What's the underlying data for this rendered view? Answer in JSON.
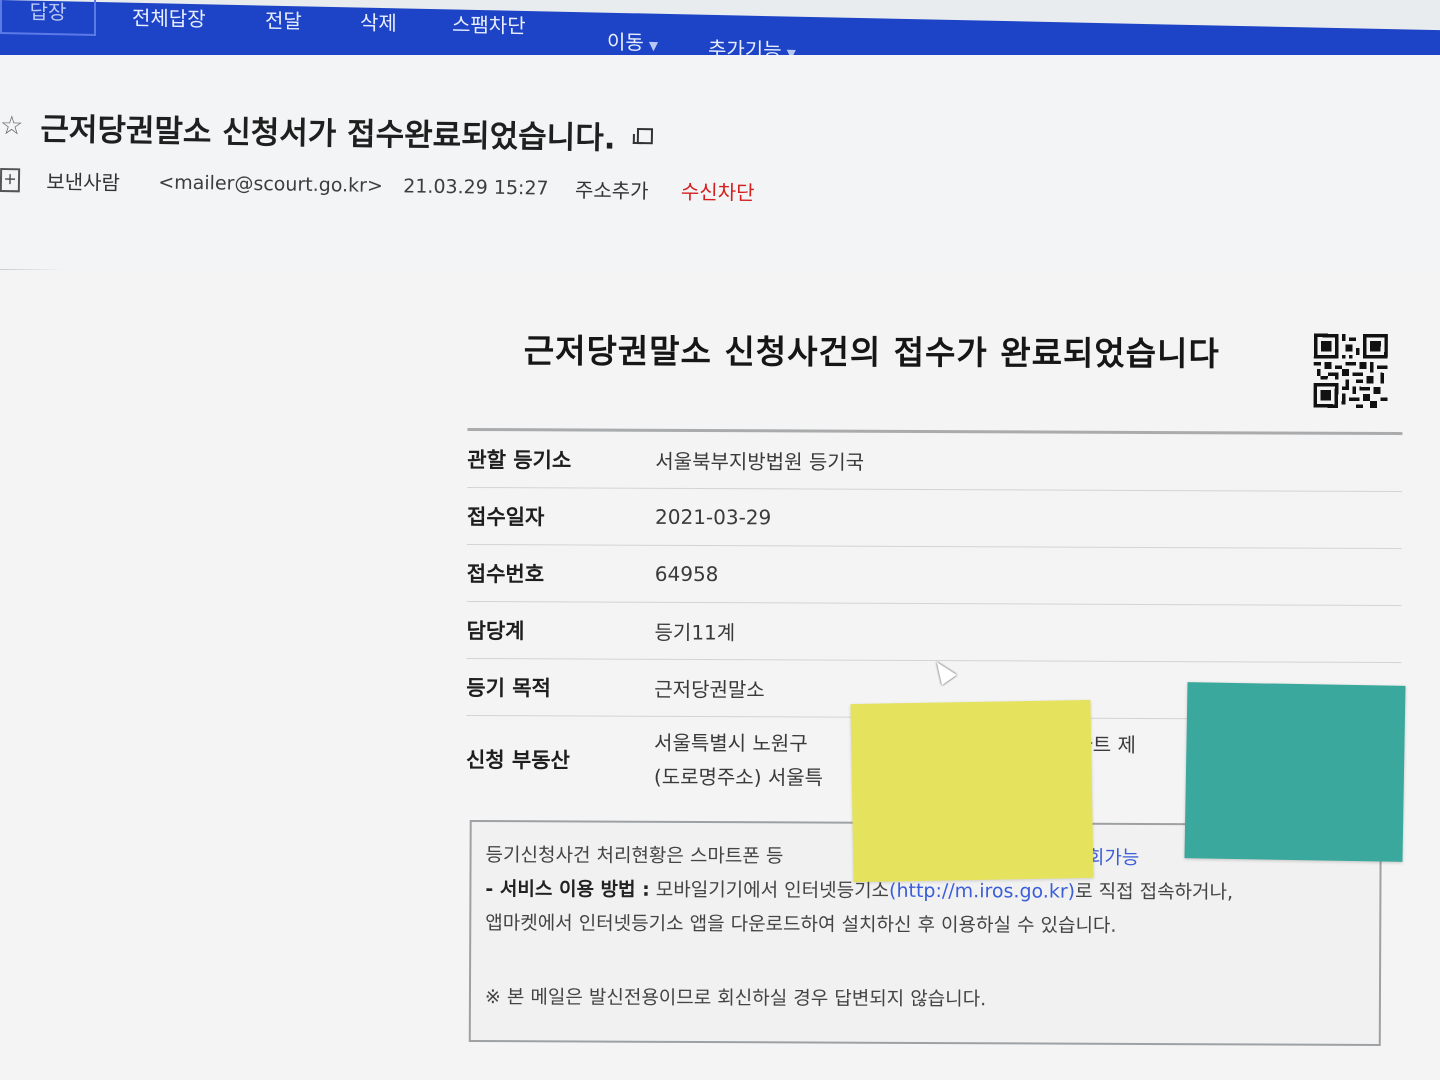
{
  "toolbar": {
    "items": [
      {
        "label": "답장"
      },
      {
        "label": "전체답장"
      },
      {
        "label": "전달"
      },
      {
        "label": "삭제"
      },
      {
        "label": "스팸차단"
      },
      {
        "label": "이동"
      },
      {
        "label": "추가기능"
      }
    ],
    "background_color": "#1d44c6"
  },
  "header": {
    "subject": "근저당권말소 신청서가 접수완료되었습니다.",
    "sender_label": "보낸사람",
    "sender_email": "<mailer@scourt.go.kr>",
    "date": "21.03.29 15:27",
    "add_address": "주소추가",
    "block_sender": "수신차단",
    "block_color": "#d51f1f",
    "icons": [
      "star-icon",
      "copy-icon",
      "plus-icon"
    ]
  },
  "body": {
    "title": "근저당권말소 신청사건의 접수가 완료되었습니다",
    "rows": [
      {
        "label": "관할 등기소",
        "value": "서울북부지방법원 등기국"
      },
      {
        "label": "접수일자",
        "value": "2021-03-29"
      },
      {
        "label": "접수번호",
        "value": "64958"
      },
      {
        "label": "담당계",
        "value": "등기11계"
      },
      {
        "label": "등기 목적",
        "value": "근저당권말소"
      },
      {
        "label": "신청 부동산",
        "value_line1": "서울특별시 노원구",
        "value_line1_tail": "론아파트 제",
        "value_line2": "(도로명주소) 서울특"
      }
    ],
    "notice": {
      "line1_start": "등기신청사건 처리현황은 스마트폰 등",
      "line1_end": "조회가능",
      "line2_bold": "- 서비스 이용 방법 :",
      "line2_text": " 모바일기기에서 인터넷등기소",
      "line2_link": "(http://m.iros.go.kr)",
      "line2_tail": "로 직접 접속하거나,",
      "line3": "앱마켓에서 인터넷등기소 앱을 다운로드하여 설치하신 후 이용하실 수 있습니다.",
      "line4": "※ 본 메일은 발신전용이므로 회신하실 경우 답변되지 않습니다."
    }
  }
}
